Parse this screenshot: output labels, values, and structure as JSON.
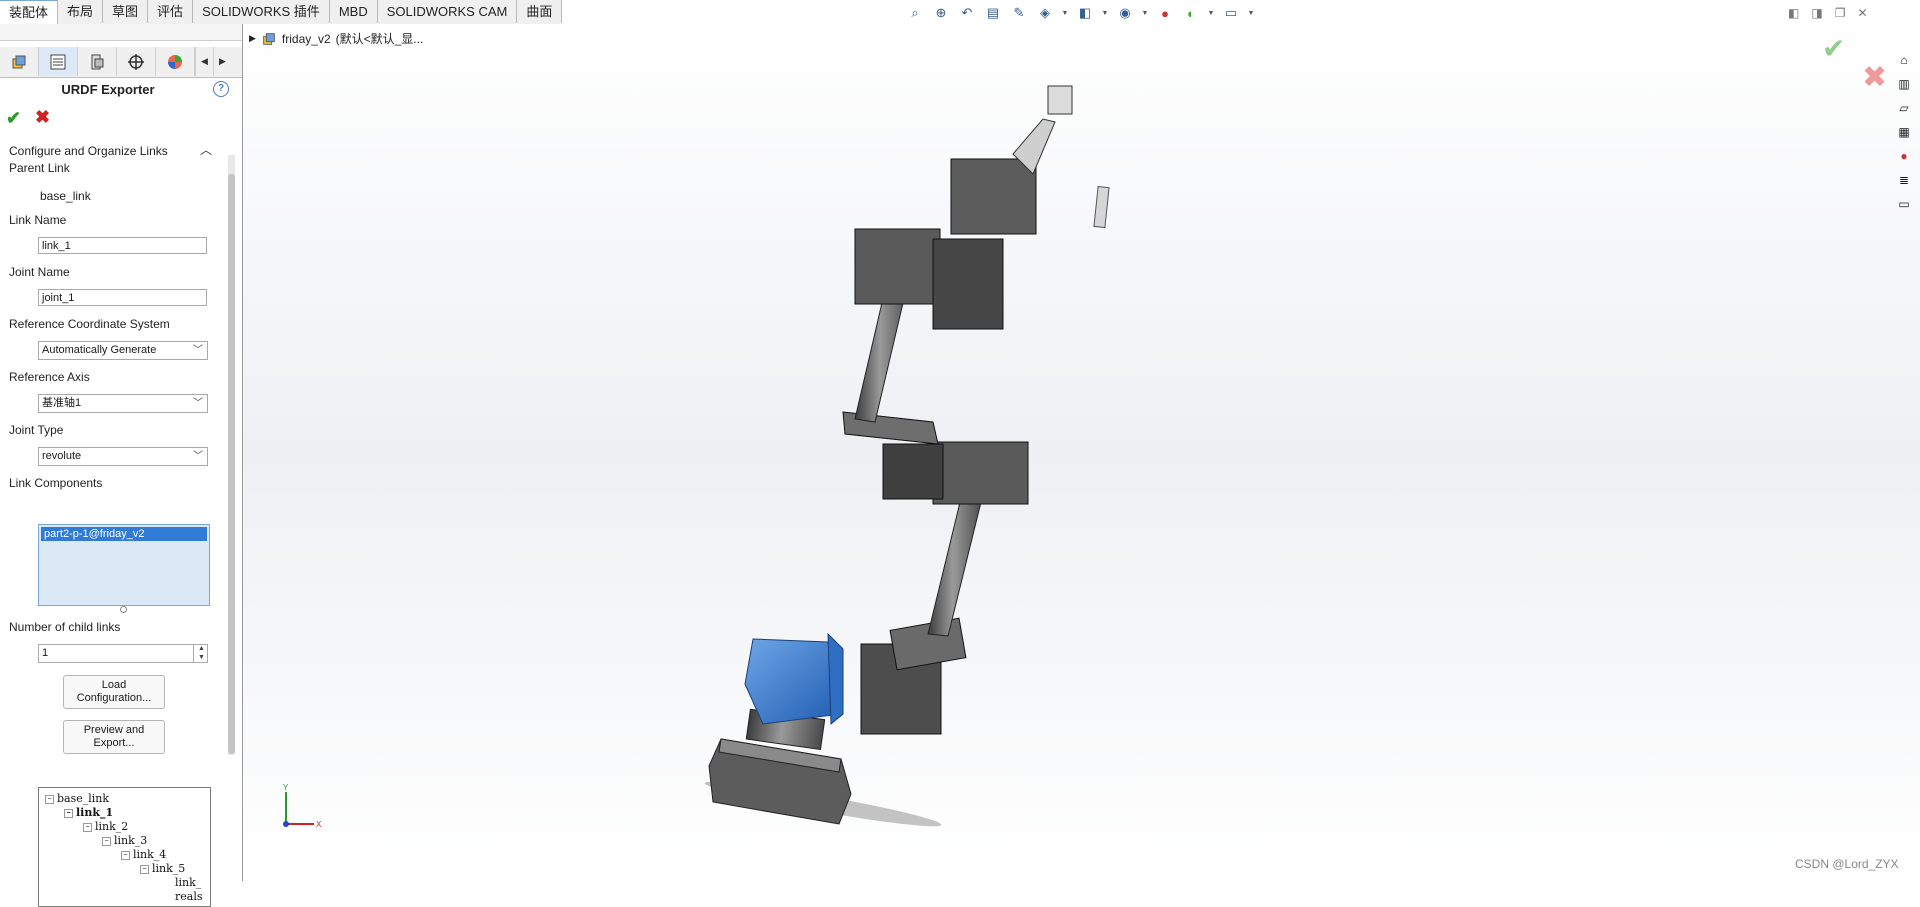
{
  "tabs": [
    "装配体",
    "布局",
    "草图",
    "评估",
    "SOLIDWORKS 插件",
    "MBD",
    "SOLIDWORKS CAM",
    "曲面"
  ],
  "panel": {
    "title": "URDF Exporter",
    "group_header": "Configure and Organize Links",
    "parent_link_label": "Parent Link",
    "parent_link_value": "base_link",
    "link_name_label": "Link Name",
    "link_name_value": "link_1",
    "joint_name_label": "Joint Name",
    "joint_name_value": "joint_1",
    "ref_coord_label": "Reference Coordinate System",
    "ref_coord_value": "Automatically Generate",
    "ref_axis_label": "Reference Axis",
    "ref_axis_value": "基准轴1",
    "joint_type_label": "Joint Type",
    "joint_type_value": "revolute",
    "link_components_label": "Link Components",
    "link_components_selected": "part2-p-1@friday_v2",
    "child_links_label": "Number of child links",
    "child_links_value": "1",
    "load_button": "Load Configuration...",
    "preview_button": "Preview and Export..."
  },
  "tree": {
    "nodes": [
      "base_link",
      "link_1",
      "link_2",
      "link_3",
      "link_4",
      "link_5",
      "link_",
      "reals"
    ]
  },
  "viewport": {
    "document": "friday_v2",
    "config": "(默认<默认_显..."
  },
  "watermark": "CSDN @Lord_ZYX",
  "colors": {
    "accent": "#2f7bd6",
    "ok": "#2a9a2a",
    "cancel": "#d42020",
    "highlight_part": "#2e6fc4"
  }
}
